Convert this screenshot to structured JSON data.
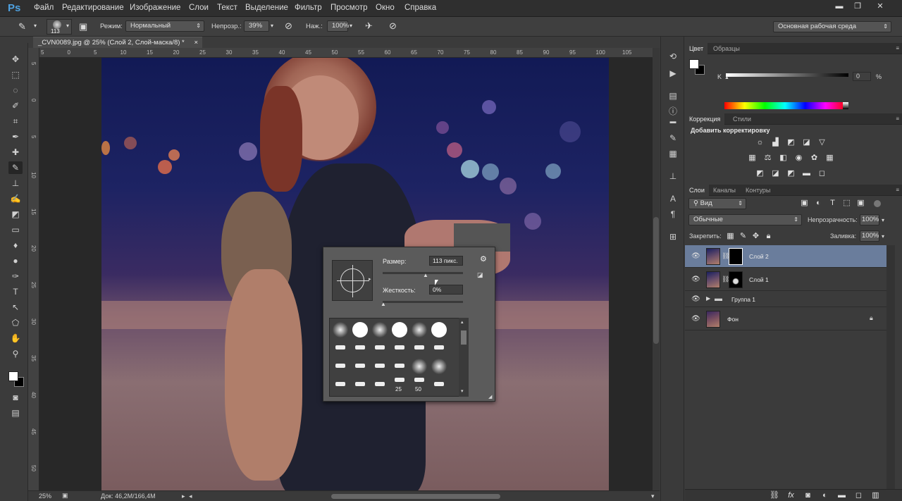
{
  "app": {
    "logo": "Ps",
    "minimize": "▬",
    "restore": "❐",
    "close": "✕"
  },
  "menu": [
    "Файл",
    "Редактирование",
    "Изображение",
    "Слои",
    "Текст",
    "Выделение",
    "Фильтр",
    "Просмотр",
    "Окно",
    "Справка"
  ],
  "options": {
    "brush_size": "113",
    "mode_label": "Режим:",
    "mode_value": "Нормальный",
    "opacity_label": "Непрозр.:",
    "opacity_value": "39%",
    "pressure_label": "Наж.:",
    "pressure_value": "100%",
    "workspace": "Основная рабочая среда"
  },
  "document": {
    "tab_title": "_CVN0089.jpg @ 25% (Слой 2, Слой-маска/8) *",
    "close": "×",
    "ruler_top": [
      "5",
      "0",
      "5",
      "10",
      "15",
      "20",
      "25",
      "30",
      "35",
      "40",
      "45",
      "50",
      "55",
      "60",
      "65",
      "70",
      "75",
      "80",
      "85",
      "90",
      "95",
      "100",
      "105"
    ],
    "ruler_left": [
      "5",
      "0",
      "5",
      "10",
      "15",
      "20",
      "25",
      "30",
      "35",
      "40",
      "45",
      "50"
    ],
    "zoom": "25%",
    "doc_info": "Док: 46,2M/166,4M"
  },
  "brush_popup": {
    "size_label": "Размер:",
    "size_value": "113 пикс.",
    "hardness_label": "Жесткость:",
    "hardness_value": "0%",
    "preset_labels": [
      "25",
      "50"
    ]
  },
  "color_panel": {
    "tabs": [
      "Цвет",
      "Образцы"
    ],
    "k_label": "K",
    "k_value": "0",
    "percent": "%"
  },
  "adjustments_panel": {
    "tabs": [
      "Коррекция",
      "Стили"
    ],
    "title": "Добавить корректировку"
  },
  "layers_panel": {
    "tabs": [
      "Слои",
      "Каналы",
      "Контуры"
    ],
    "filter": "Вид",
    "blend_mode": "Обычные",
    "opacity_label": "Непрозрачность:",
    "opacity_value": "100%",
    "lock_label": "Закрепить:",
    "fill_label": "Заливка:",
    "fill_value": "100%",
    "layers": [
      {
        "name": "Слой 2"
      },
      {
        "name": "Слой 1"
      },
      {
        "name": "Группа 1"
      },
      {
        "name": "Фон"
      }
    ],
    "bottom_icons": [
      "link-icon",
      "fx-icon",
      "mask-icon",
      "adjustment-icon",
      "folder-icon",
      "new-layer-icon",
      "trash-icon"
    ],
    "fx": "fx"
  }
}
